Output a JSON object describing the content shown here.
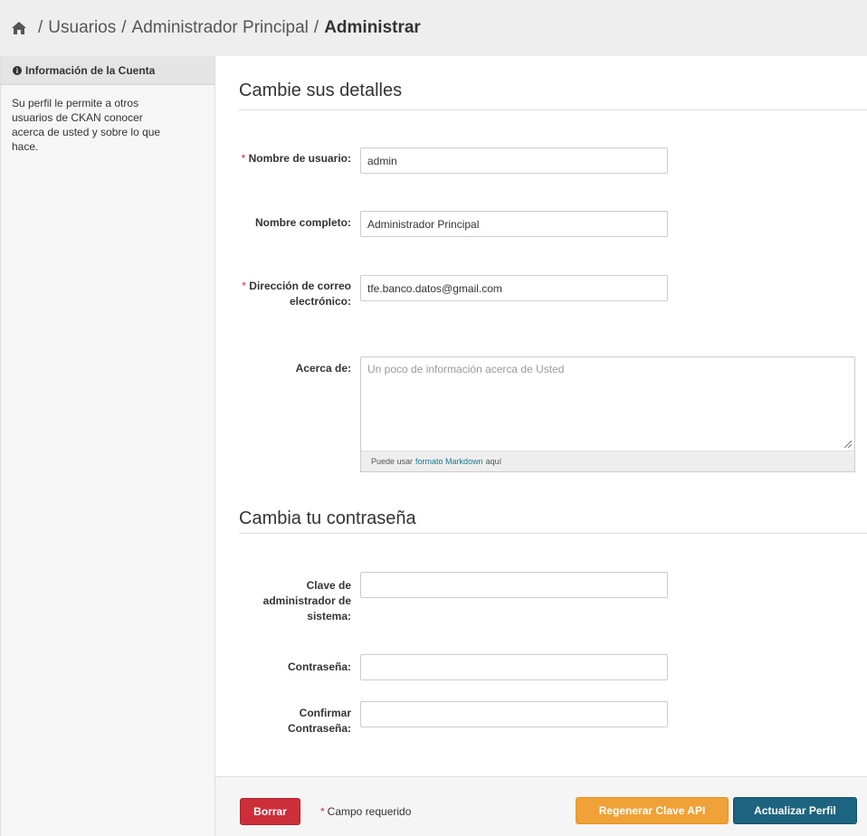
{
  "breadcrumb": {
    "items": [
      "Usuarios",
      "Administrador Principal"
    ],
    "active": "Administrar",
    "separator": "/"
  },
  "sidebar": {
    "heading": "Información de la Cuenta",
    "text": "Su perfil le permite a otros usuarios de CKAN conocer acerca de usted y sobre lo que hace."
  },
  "details": {
    "title": "Cambie sus detalles",
    "required_mark": "*",
    "username_label": "Nombre de usuario:",
    "username_value": "admin",
    "fullname_label": "Nombre completo:",
    "fullname_value": "Administrador Principal",
    "email_label": "Dirección de correo electrónico:",
    "email_value": "tfe.banco.datos@gmail.com",
    "about_label": "Acerca de:",
    "about_placeholder": "Un poco de información acerca de Usted",
    "markdown_prefix": "Puede usar",
    "markdown_link": "formato Markdown",
    "markdown_suffix": "aquí"
  },
  "password": {
    "title": "Cambia tu contraseña",
    "sysadmin_label": "Clave de administrador de sistema:",
    "password_label": "Contraseña:",
    "confirm_label": "Confirmar Contraseña:"
  },
  "actions": {
    "delete_label": "Borrar",
    "required_note": "Campo requerido",
    "regenerate_label": "Regenerar Clave API",
    "update_label": "Actualizar Perfil"
  },
  "colors": {
    "danger": "#cd2f3a",
    "warning": "#f0a137",
    "primary": "#1c6480",
    "required": "#c6303e"
  }
}
